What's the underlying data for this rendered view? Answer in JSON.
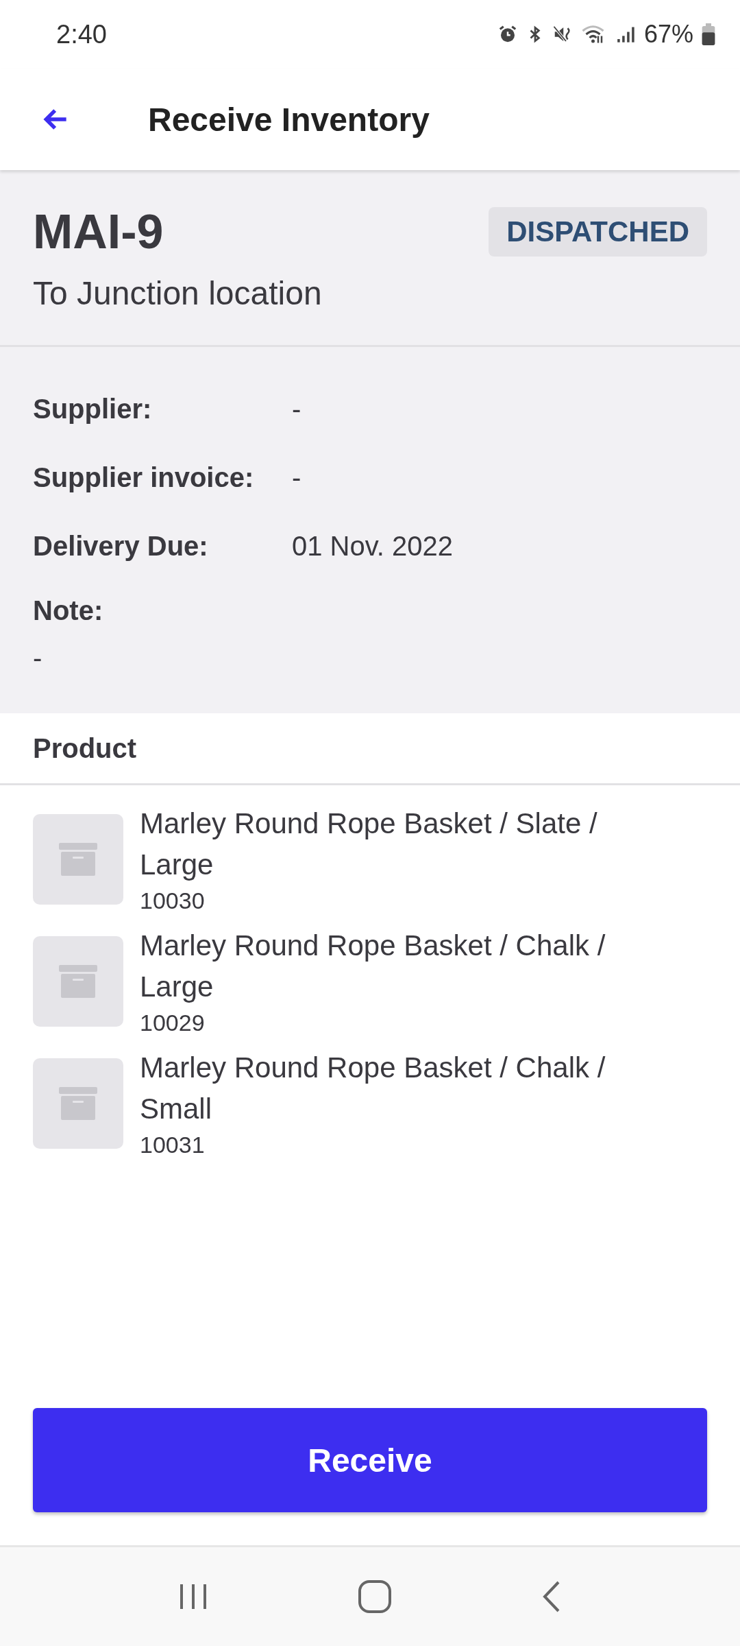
{
  "status_bar": {
    "time": "2:40",
    "battery": "67%"
  },
  "header": {
    "title": "Receive Inventory"
  },
  "transfer": {
    "id": "MAI-9",
    "status": "DISPATCHED",
    "destination": "To Junction location"
  },
  "details": [
    {
      "label": "Supplier:",
      "value": "-"
    },
    {
      "label": "Supplier invoice:",
      "value": "-"
    },
    {
      "label": "Delivery Due:",
      "value": "01 Nov. 2022"
    }
  ],
  "note": {
    "label": "Note:",
    "value": "-"
  },
  "products": {
    "heading": "Product",
    "items": [
      {
        "name": "Marley Round Rope Basket / Slate / Large",
        "sku": "10030"
      },
      {
        "name": "Marley Round Rope Basket / Chalk / Large",
        "sku": "10029"
      },
      {
        "name": "Marley Round Rope Basket / Chalk / Small",
        "sku": "10031"
      }
    ]
  },
  "action": {
    "label": "Receive"
  }
}
